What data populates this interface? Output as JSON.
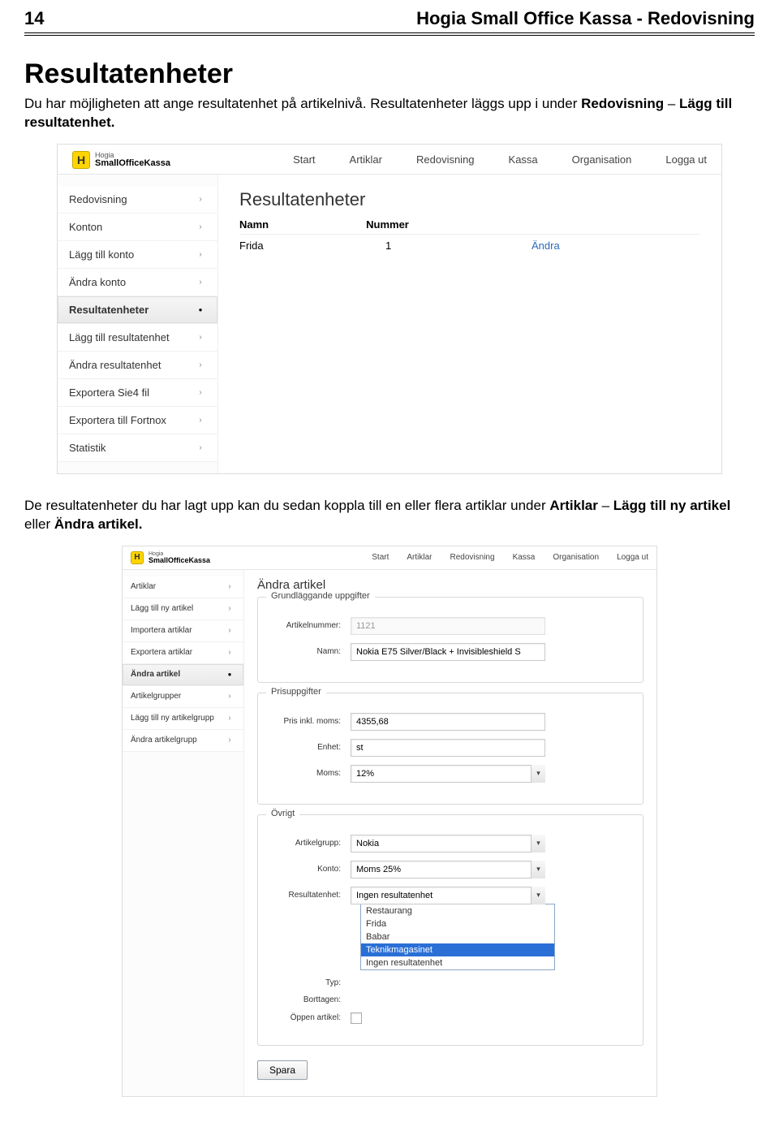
{
  "doc": {
    "page_number": "14",
    "doc_title": "Hogia Small Office Kassa - Redovisning",
    "section_title": "Resultatenheter",
    "para1_pre": "Du har möjligheten att ange resultatenhet på artikelnivå. Resultatenheter läggs upp i under ",
    "para1_b1": "Redovisning",
    "para1_mid": " – ",
    "para1_b2": "Lägg till resultatenhet.",
    "para2_pre": "De resultatenheter du har lagt upp kan du sedan koppla till en eller flera artiklar under ",
    "para2_b1": "Artiklar",
    "para2_mid1": " – ",
    "para2_b2": "Lägg till ny artikel",
    "para2_mid2": " eller ",
    "para2_b3": "Ändra artikel."
  },
  "app": {
    "logo_letter": "H",
    "logo_line1": "Hogia",
    "logo_line2": "SmallOfficeKassa",
    "topnav": [
      "Start",
      "Artiklar",
      "Redovisning",
      "Kassa",
      "Organisation",
      "Logga ut"
    ]
  },
  "shot1": {
    "sidebar": {
      "items": [
        {
          "label": "Redovisning"
        },
        {
          "label": "Konton"
        },
        {
          "label": "Lägg till konto"
        },
        {
          "label": "Ändra konto"
        },
        {
          "label": "Resultatenheter",
          "active": true
        },
        {
          "label": "Lägg till resultatenhet"
        },
        {
          "label": "Ändra resultatenhet"
        },
        {
          "label": "Exportera Sie4 fil"
        },
        {
          "label": "Exportera till Fortnox"
        },
        {
          "label": "Statistik"
        }
      ]
    },
    "main": {
      "title": "Resultatenheter",
      "th_namn": "Namn",
      "th_nummer": "Nummer",
      "row_namn": "Frida",
      "row_nummer": "1",
      "row_action": "Ändra"
    }
  },
  "shot2": {
    "sidebar": {
      "items": [
        {
          "label": "Artiklar"
        },
        {
          "label": "Lägg till ny artikel"
        },
        {
          "label": "Importera artiklar"
        },
        {
          "label": "Exportera artiklar"
        },
        {
          "label": "Ändra artikel",
          "active": true
        },
        {
          "label": "Artikelgrupper"
        },
        {
          "label": "Lägg till ny artikelgrupp"
        },
        {
          "label": "Ändra artikelgrupp"
        }
      ]
    },
    "main": {
      "title": "Ändra artikel",
      "fs1": {
        "legend": "Grundläggande uppgifter",
        "artikelnummer_label": "Artikelnummer:",
        "artikelnummer_value": "1121",
        "namn_label": "Namn:",
        "namn_value": "Nokia E75 Silver/Black + Invisibleshield S"
      },
      "fs2": {
        "legend": "Prisuppgifter",
        "pris_label": "Pris inkl. moms:",
        "pris_value": "4355,68",
        "enhet_label": "Enhet:",
        "enhet_value": "st",
        "moms_label": "Moms:",
        "moms_value": "12%"
      },
      "fs3": {
        "legend": "Övrigt",
        "artikelgrupp_label": "Artikelgrupp:",
        "artikelgrupp_value": "Nokia",
        "konto_label": "Konto:",
        "konto_value": "Moms 25%",
        "resultatenhet_label": "Resultatenhet:",
        "resultatenhet_value": "Ingen resultatenhet",
        "resultatenhet_options": [
          "Restaurang",
          "Frida",
          "Babar",
          "Teknikmagasinet",
          "Ingen resultatenhet"
        ],
        "resultatenhet_selected_index": 3,
        "typ_label": "Typ:",
        "borttagen_label": "Borttagen:",
        "oppen_label": "Öppen artikel:"
      },
      "save_label": "Spara"
    }
  }
}
